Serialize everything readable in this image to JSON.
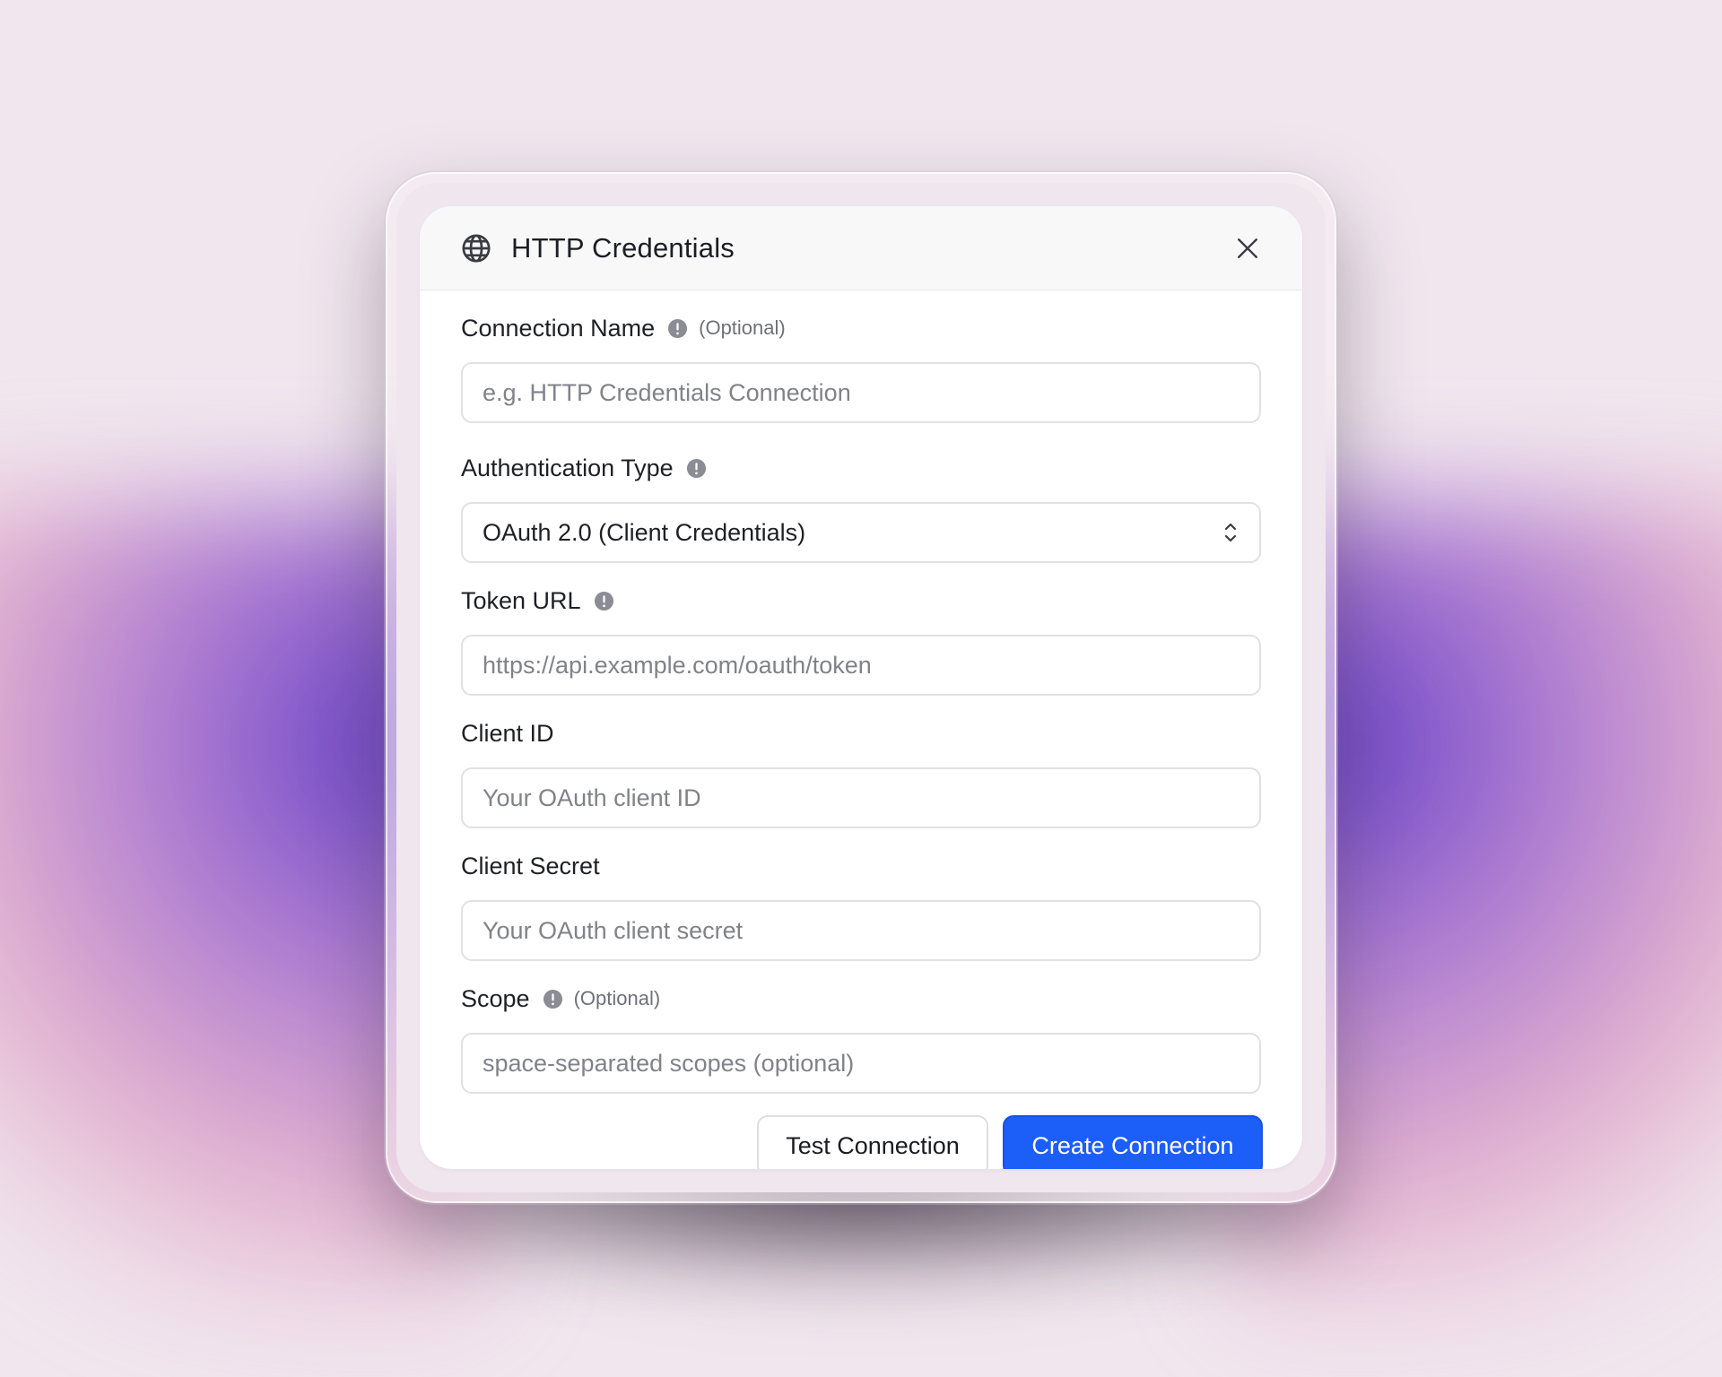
{
  "dialog": {
    "title": "HTTP Credentials",
    "icons": {
      "header": "globe-icon",
      "close": "close-icon",
      "info": "info-icon",
      "select": "chevron-updown-icon"
    }
  },
  "fields": {
    "connection_name": {
      "label": "Connection Name",
      "optional": "(Optional)",
      "placeholder": "e.g. HTTP Credentials Connection",
      "value": ""
    },
    "auth_type": {
      "label": "Authentication Type",
      "selected": "OAuth 2.0 (Client Credentials)"
    },
    "token_url": {
      "label": "Token URL",
      "placeholder": "https://api.example.com/oauth/token",
      "value": ""
    },
    "client_id": {
      "label": "Client ID",
      "placeholder": "Your OAuth client ID",
      "value": ""
    },
    "client_secret": {
      "label": "Client Secret",
      "placeholder": "Your OAuth client secret",
      "value": ""
    },
    "scope": {
      "label": "Scope",
      "optional": "(Optional)",
      "placeholder": "space-separated scopes (optional)",
      "value": ""
    }
  },
  "buttons": {
    "test": "Test Connection",
    "create": "Create Connection"
  },
  "colors": {
    "primary": "#1c5ef8",
    "accent_purple": "#6038c4",
    "accent_pink": "#d684b4"
  }
}
